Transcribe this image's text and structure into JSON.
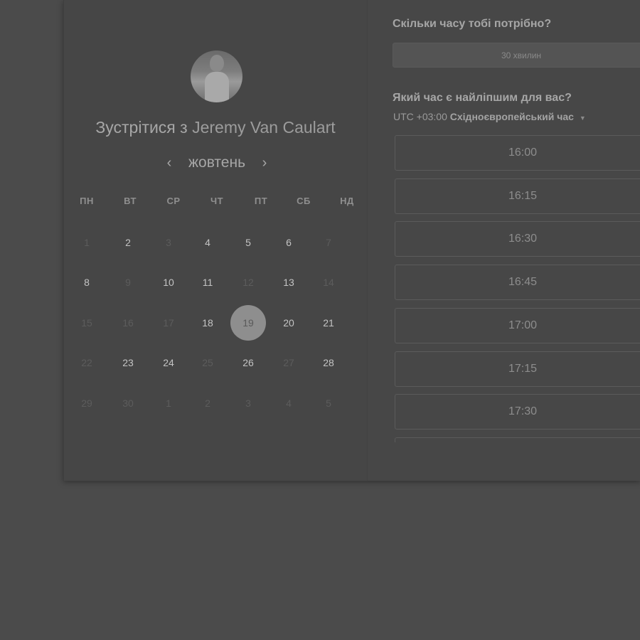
{
  "scheduler": {
    "title_prefix": "Зустрітися з",
    "host_name": "Jeremy Van Caulart",
    "month": "жовтень",
    "prev_icon": "‹",
    "next_icon": "›",
    "weekdays": [
      "ПН",
      "ВТ",
      "СР",
      "ЧТ",
      "ПТ",
      "СБ",
      "НД"
    ],
    "weeks": [
      [
        {
          "d": "1",
          "available": false
        },
        {
          "d": "2",
          "available": true
        },
        {
          "d": "3",
          "available": false
        },
        {
          "d": "4",
          "available": true
        },
        {
          "d": "5",
          "available": true
        },
        {
          "d": "6",
          "available": true
        },
        {
          "d": "7",
          "available": false
        }
      ],
      [
        {
          "d": "8",
          "available": true
        },
        {
          "d": "9",
          "available": false
        },
        {
          "d": "10",
          "available": true
        },
        {
          "d": "11",
          "available": true
        },
        {
          "d": "12",
          "available": false
        },
        {
          "d": "13",
          "available": true
        },
        {
          "d": "14",
          "available": false
        }
      ],
      [
        {
          "d": "15",
          "available": false
        },
        {
          "d": "16",
          "available": false
        },
        {
          "d": "17",
          "available": false
        },
        {
          "d": "18",
          "available": true
        },
        {
          "d": "19",
          "available": true,
          "selected": true
        },
        {
          "d": "20",
          "available": true
        },
        {
          "d": "21",
          "available": true
        }
      ],
      [
        {
          "d": "22",
          "available": false
        },
        {
          "d": "23",
          "available": true
        },
        {
          "d": "24",
          "available": true
        },
        {
          "d": "25",
          "available": false
        },
        {
          "d": "26",
          "available": true
        },
        {
          "d": "27",
          "available": false
        },
        {
          "d": "28",
          "available": true
        }
      ],
      [
        {
          "d": "29",
          "available": false
        },
        {
          "d": "30",
          "available": false
        },
        {
          "d": "1",
          "available": false
        },
        {
          "d": "2",
          "available": false
        },
        {
          "d": "3",
          "available": false
        },
        {
          "d": "4",
          "available": false
        },
        {
          "d": "5",
          "available": false
        }
      ]
    ]
  },
  "booking": {
    "duration_question": "Скільки часу тобі потрібно?",
    "duration_value": "30 хвилин",
    "time_question": "Який час є найліпшим для вас?",
    "tz_offset": "UTC +03:00",
    "tz_name": "Східноєвропейський час",
    "tz_caret": "▼",
    "slots": [
      "16:00",
      "16:15",
      "16:30",
      "16:45",
      "17:00",
      "17:15",
      "17:30",
      ""
    ]
  }
}
